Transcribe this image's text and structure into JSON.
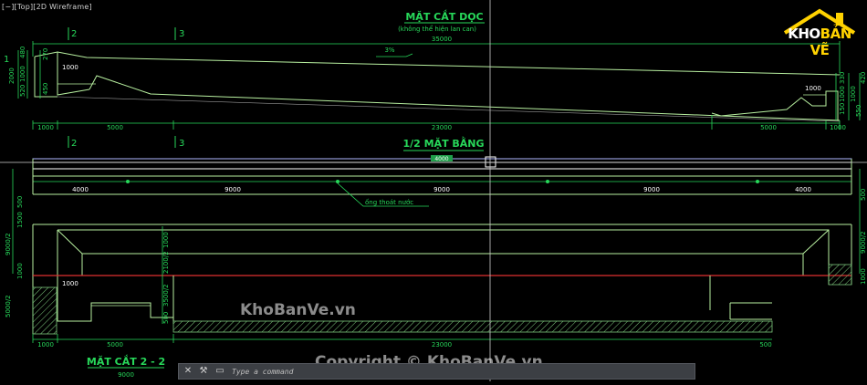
{
  "viewport": {
    "label": "[−][Top][2D Wireframe]"
  },
  "section_top": {
    "title": "MẶT CẮT DỌC",
    "subtitle": "(không thể hiện lan can)",
    "overall_length": "35000",
    "slope": "3%",
    "markers": [
      "2",
      "3"
    ],
    "level_label": "1",
    "left_dims": [
      "2000",
      "480",
      "270",
      "1000",
      "520",
      "450"
    ],
    "left_inner_dim": "1000",
    "right_dims": [
      "1000",
      "420",
      "330",
      "1000",
      "550",
      "150"
    ],
    "right_inner_dim": "1000",
    "bottom_dims": [
      "1000",
      "5000",
      "23000",
      "5000",
      "1000"
    ]
  },
  "plan": {
    "title": "1/2 MẶT BẰNG",
    "markers": [
      "2",
      "3"
    ],
    "tag_label": "4000",
    "segment_dims": [
      "4000",
      "9000",
      "9000",
      "9000",
      "4000"
    ],
    "left_dims": [
      "500",
      "1500",
      "9000/2"
    ],
    "right_dims": [
      "500",
      "9000/2"
    ],
    "drain_label": "ống thoát nước"
  },
  "section_22": {
    "title": "MẶT CẮT 2 - 2",
    "width_dim": "9000",
    "left_dims": [
      "1000",
      "5000/2"
    ],
    "inner_dims": [
      "1000",
      "2100/2",
      "3500/2",
      "500"
    ],
    "inner_label": "1000",
    "right_dims": [
      "1000"
    ],
    "bottom_dims": [
      "1000",
      "5000",
      "23000",
      "500"
    ]
  },
  "watermarks": {
    "center": "KhoBanVe.vn",
    "copyright": "Copyright © KhoBanVe.vn"
  },
  "logo": {
    "prefix": "KHO",
    "suffix": "BẢN VẼ"
  },
  "command_line": {
    "placeholder": "Type a command",
    "close_icon": "close-icon",
    "settings_icon": "wrench-icon"
  },
  "colors": {
    "background": "#000000",
    "geometry": "#ffffff",
    "dimension": "#22d35a",
    "structure": "#b8f0a0",
    "red_line": "#e03030",
    "crosshair": "#cfcfcf"
  }
}
